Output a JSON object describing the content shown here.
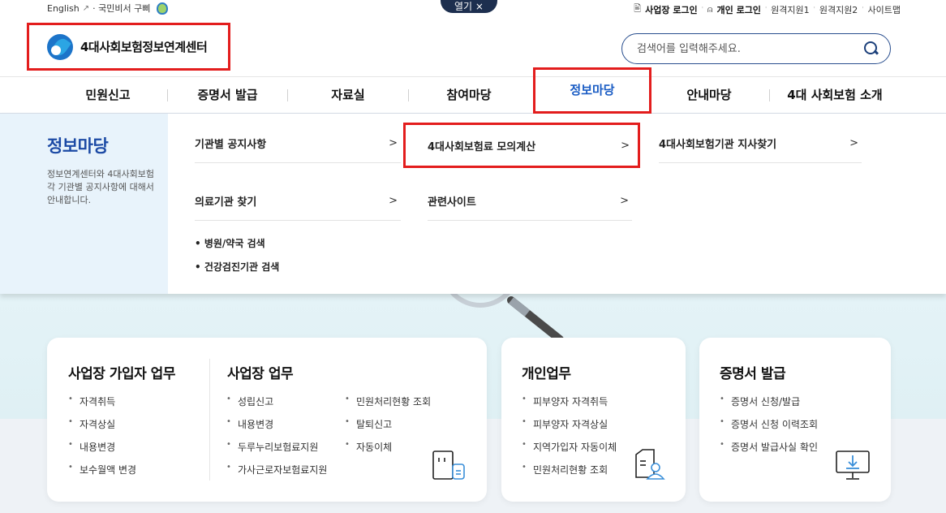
{
  "util": {
    "english": "English",
    "citizen_secretary": "· 국민비서 구삐",
    "popup_tab": "열기 ×",
    "business_login": "사업장 로그인",
    "personal_login": "개인 로그인",
    "remote1": "원격지원1",
    "remote2": "원격지원2",
    "sitemap": "사이트맵"
  },
  "header": {
    "logo_text": "4대사회보험정보연계센터",
    "search_placeholder": "검색어를 입력해주세요."
  },
  "gnb": [
    {
      "label": "민원신고"
    },
    {
      "label": "증명서 발급"
    },
    {
      "label": "자료실"
    },
    {
      "label": "참여마당"
    },
    {
      "label": "정보마당"
    },
    {
      "label": "안내마당"
    },
    {
      "label": "4대 사회보험 소개"
    }
  ],
  "panel": {
    "title": "정보마당",
    "desc": "정보연계센터와 4대사회보험 각 기관별 공지사항에 대해서 안내합니다.",
    "links": [
      {
        "label": "기관별 공지사항"
      },
      {
        "label": "4대사회보험료 모의계산"
      },
      {
        "label": "4대사회보험기관 지사찾기"
      },
      {
        "label": "의료기관 찾기"
      },
      {
        "label": "관련사이트"
      }
    ],
    "sublinks": [
      "• 병원/약국 검색",
      "• 건강검진기관 검색"
    ],
    "chevron": ">"
  },
  "cards": {
    "business_join": {
      "title": "사업장 가입자 업무",
      "items": [
        "자격취득",
        "자격상실",
        "내용변경",
        "보수월액 변경"
      ]
    },
    "business": {
      "title": "사업장 업무",
      "col1": [
        "성립신고",
        "내용변경",
        "두루누리보험료지원",
        "가사근로자보험료지원"
      ],
      "col2": [
        "민원처리현황 조회",
        "탈퇴신고",
        "자동이체"
      ]
    },
    "personal": {
      "title": "개인업무",
      "items": [
        "피부양자 자격취득",
        "피부양자 자격상실",
        "지역가입자 자동이체",
        "민원처리현황 조회"
      ]
    },
    "certificate": {
      "title": "증명서 발급",
      "items": [
        "증명서 신청/발급",
        "증명서 신청 이력조회",
        "증명서 발급사실 확인"
      ]
    }
  },
  "colors": {
    "accent": "#1a5cc4",
    "highlight": "#e31d1d",
    "panel_bg": "#e8f3fb"
  }
}
